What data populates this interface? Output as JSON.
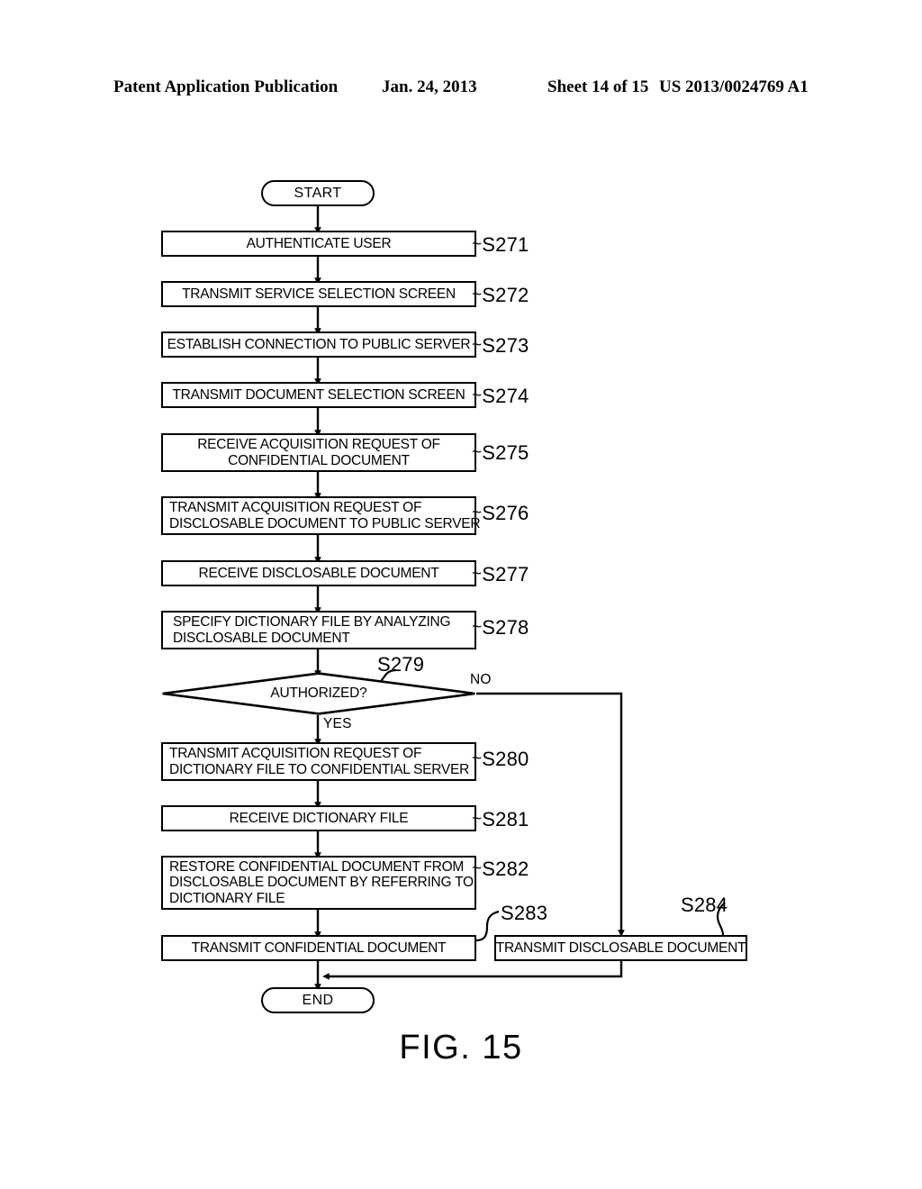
{
  "header": {
    "publication": "Patent Application Publication",
    "date": "Jan. 24, 2013",
    "sheet": "Sheet 14 of 15",
    "number": "US 2013/0024769 A1"
  },
  "figure": {
    "caption": "FIG. 15"
  },
  "flowchart": {
    "start": {
      "label": "START"
    },
    "end": {
      "label": "END"
    },
    "decision": {
      "label": "AUTHORIZED?",
      "ref": "S279",
      "yes_label": "YES",
      "no_label": "NO"
    },
    "steps": [
      {
        "ref": "S271",
        "lines": [
          "AUTHENTICATE USER"
        ],
        "align": "center"
      },
      {
        "ref": "S272",
        "lines": [
          "TRANSMIT SERVICE SELECTION SCREEN"
        ],
        "align": "center"
      },
      {
        "ref": "S273",
        "lines": [
          "ESTABLISH CONNECTION TO PUBLIC SERVER"
        ],
        "align": "center"
      },
      {
        "ref": "S274",
        "lines": [
          "TRANSMIT DOCUMENT SELECTION SCREEN"
        ],
        "align": "center"
      },
      {
        "ref": "S275",
        "lines": [
          "RECEIVE ACQUISITION REQUEST OF",
          "CONFIDENTIAL DOCUMENT"
        ],
        "align": "center"
      },
      {
        "ref": "S276",
        "lines": [
          "TRANSMIT ACQUISITION REQUEST OF",
          "DISCLOSABLE DOCUMENT TO PUBLIC SERVER"
        ],
        "align": "left"
      },
      {
        "ref": "S277",
        "lines": [
          "RECEIVE DISCLOSABLE DOCUMENT"
        ],
        "align": "center"
      },
      {
        "ref": "S278",
        "lines": [
          "SPECIFY DICTIONARY FILE BY ANALYZING",
          "DISCLOSABLE DOCUMENT"
        ],
        "align": "left"
      },
      {
        "ref": "S280",
        "lines": [
          "TRANSMIT ACQUISITION REQUEST OF",
          "DICTIONARY FILE TO CONFIDENTIAL SERVER"
        ],
        "align": "left"
      },
      {
        "ref": "S281",
        "lines": [
          "RECEIVE DICTIONARY FILE"
        ],
        "align": "center"
      },
      {
        "ref": "S282",
        "lines": [
          "RESTORE CONFIDENTIAL DOCUMENT FROM",
          "DISCLOSABLE DOCUMENT BY REFERRING TO",
          "DICTIONARY FILE"
        ],
        "align": "left"
      },
      {
        "ref": "S283",
        "lines": [
          "TRANSMIT CONFIDENTIAL DOCUMENT"
        ],
        "align": "center"
      },
      {
        "ref": "S284",
        "lines": [
          "TRANSMIT DISCLOSABLE DOCUMENT"
        ],
        "align": "center"
      }
    ]
  },
  "colors": {
    "ink": "#000000",
    "paper": "#ffffff"
  }
}
